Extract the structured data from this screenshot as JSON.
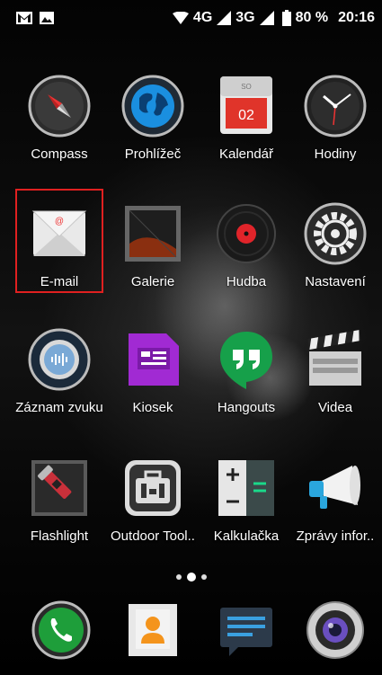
{
  "status_bar": {
    "left_icons": [
      "gmail-icon",
      "image-icon"
    ],
    "network_4g": "4G",
    "network_3g": "3G",
    "battery": "80 %",
    "time": "20:16"
  },
  "apps": [
    {
      "label": "Compass",
      "icon": "compass-icon"
    },
    {
      "label": "Prohlížeč",
      "icon": "browser-globe-icon"
    },
    {
      "label": "Kalendář",
      "icon": "calendar-icon",
      "calendar_day": "SO",
      "calendar_date": "02"
    },
    {
      "label": "Hodiny",
      "icon": "clock-icon"
    },
    {
      "label": "E-mail",
      "icon": "email-envelope-icon"
    },
    {
      "label": "Galerie",
      "icon": "gallery-icon"
    },
    {
      "label": "Hudba",
      "icon": "music-record-icon"
    },
    {
      "label": "Nastavení",
      "icon": "settings-gear-icon"
    },
    {
      "label": "Záznam zvuku",
      "icon": "sound-recorder-icon"
    },
    {
      "label": "Kiosek",
      "icon": "kiosk-icon"
    },
    {
      "label": "Hangouts",
      "icon": "hangouts-icon"
    },
    {
      "label": "Videa",
      "icon": "clapperboard-icon"
    },
    {
      "label": "Flashlight",
      "icon": "flashlight-icon"
    },
    {
      "label": "Outdoor Tool..",
      "icon": "toolbox-icon"
    },
    {
      "label": "Kalkulačka",
      "icon": "calculator-icon"
    },
    {
      "label": "Zprávy infor..",
      "icon": "megaphone-icon"
    }
  ],
  "selected_app": "E-mail",
  "page_indicator": {
    "pages": 3,
    "current": 2
  },
  "dock": [
    {
      "icon": "phone-icon"
    },
    {
      "icon": "contacts-icon"
    },
    {
      "icon": "messages-icon"
    },
    {
      "icon": "camera-icon"
    }
  ],
  "colors": {
    "highlight": "#e02020",
    "calendar_red": "#e0342a",
    "kiosk_purple": "#a12ad3",
    "hangouts_green": "#16a04a",
    "phone_green": "#1e9e3a"
  }
}
